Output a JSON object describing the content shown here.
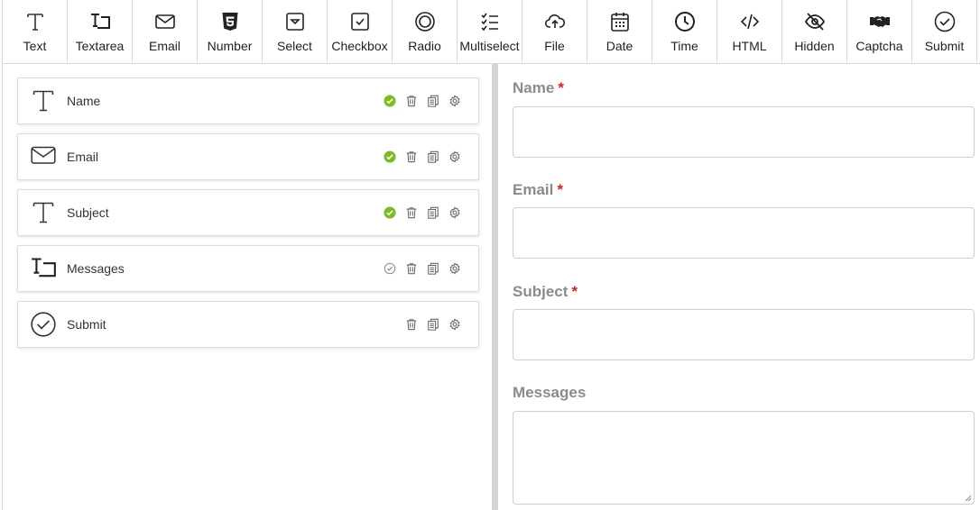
{
  "toolbar": {
    "items": [
      {
        "label": "Text",
        "icon": "text-icon"
      },
      {
        "label": "Textarea",
        "icon": "textarea-icon"
      },
      {
        "label": "Email",
        "icon": "envelope-icon"
      },
      {
        "label": "Number",
        "icon": "html5-icon"
      },
      {
        "label": "Select",
        "icon": "select-icon"
      },
      {
        "label": "Checkbox",
        "icon": "checkbox-icon"
      },
      {
        "label": "Radio",
        "icon": "radio-icon"
      },
      {
        "label": "Multiselect",
        "icon": "multiselect-icon"
      },
      {
        "label": "File",
        "icon": "cloud-upload-icon"
      },
      {
        "label": "Date",
        "icon": "calendar-icon"
      },
      {
        "label": "Time",
        "icon": "clock-icon"
      },
      {
        "label": "HTML",
        "icon": "code-icon"
      },
      {
        "label": "Hidden",
        "icon": "eye-slash-icon"
      },
      {
        "label": "Captcha",
        "icon": "handshake-icon"
      },
      {
        "label": "Submit",
        "icon": "check-circle-icon"
      }
    ]
  },
  "fields": [
    {
      "label": "Name",
      "icon": "text-icon",
      "required": true
    },
    {
      "label": "Email",
      "icon": "envelope-icon",
      "required": true
    },
    {
      "label": "Subject",
      "icon": "text-icon",
      "required": true
    },
    {
      "label": "Messages",
      "icon": "textarea-icon",
      "required": false
    },
    {
      "label": "Submit",
      "icon": "check-circle-icon",
      "required": null
    }
  ],
  "preview": {
    "fields": [
      {
        "label": "Name",
        "required_mark": "*",
        "value": ""
      },
      {
        "label": "Email",
        "required_mark": "*",
        "value": ""
      },
      {
        "label": "Subject",
        "required_mark": "*",
        "value": ""
      },
      {
        "label": "Messages",
        "required_mark": "",
        "value": ""
      }
    ]
  },
  "colors": {
    "required_check": "#7cbb26",
    "required_star": "#d12424",
    "label_gray": "#8b8b8b"
  }
}
